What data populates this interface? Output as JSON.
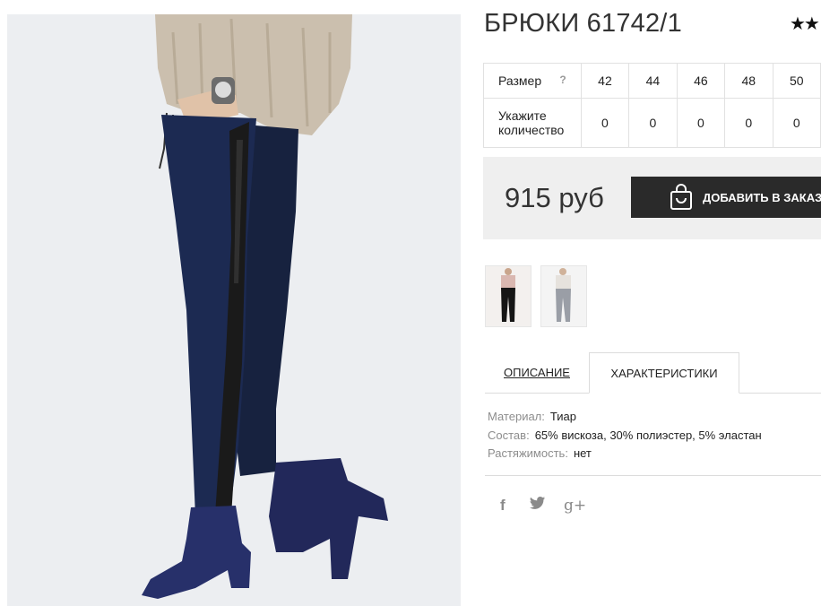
{
  "product": {
    "title": "БРЮКИ 61742/1",
    "rating_stars": "★★"
  },
  "sizes_table": {
    "size_label": "Размер",
    "help_mark": "?",
    "qty_label_line1": "Укажите",
    "qty_label_line2": "количество",
    "sizes": [
      "42",
      "44",
      "46",
      "48",
      "50"
    ],
    "quantities": [
      "0",
      "0",
      "0",
      "0",
      "0"
    ]
  },
  "purchase": {
    "price": "915 руб",
    "add_button_label": "ДОБАВИТЬ В ЗАКАЗ"
  },
  "tabs": {
    "description": "ОПИСАНИЕ",
    "characteristics": "ХАРАКТЕРИСТИКИ"
  },
  "specs": [
    {
      "key": "Материал:",
      "value": "Тиар"
    },
    {
      "key": "Состав:",
      "value": "65% вискоза, 30% полиэстер, 5% эластан"
    },
    {
      "key": "Растяжимость:",
      "value": "нет"
    }
  ],
  "social": {
    "facebook": "f",
    "twitter": "🐦",
    "googleplus": "g+"
  },
  "colors": {
    "pants": "#1c2a52",
    "stripe": "#1a1a1a",
    "sweater": "#cbbfae",
    "button_bg": "#2a2a2a",
    "price_bg": "#efefef"
  },
  "icons": [
    "bag-icon",
    "facebook-icon",
    "twitter-icon",
    "google-plus-icon"
  ]
}
